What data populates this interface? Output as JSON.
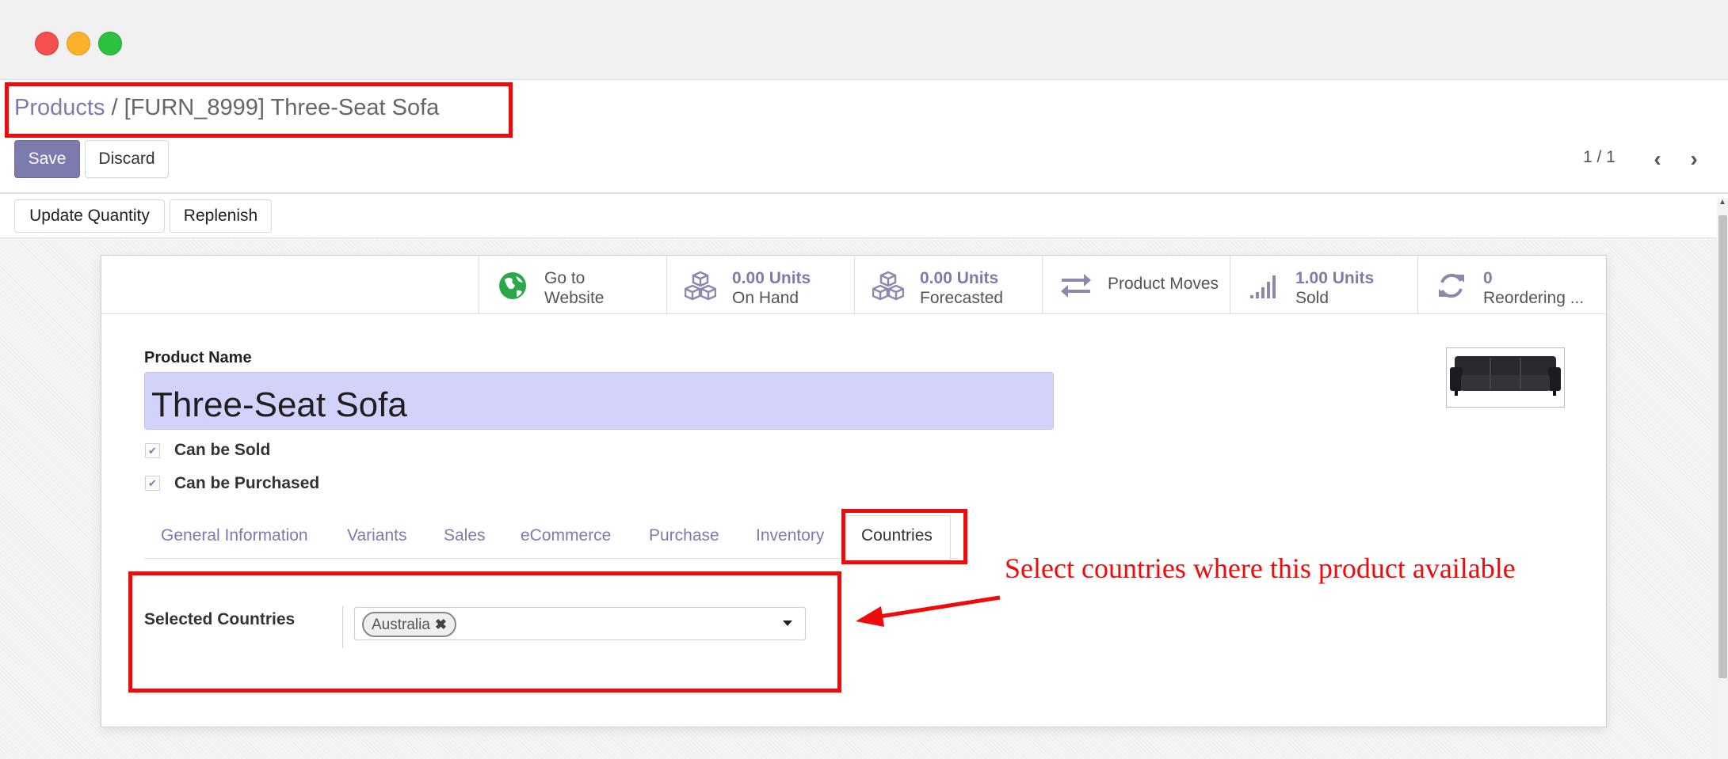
{
  "window": {
    "controls": [
      "close",
      "minimize",
      "maximize"
    ]
  },
  "breadcrumb": {
    "parent": "Products",
    "separator": "/",
    "current": "[FURN_8999] Three-Seat Sofa"
  },
  "toolbar": {
    "save_label": "Save",
    "discard_label": "Discard"
  },
  "pager": {
    "value": "1 / 1"
  },
  "actions": {
    "update_quantity": "Update Quantity",
    "replenish": "Replenish"
  },
  "smart_buttons": [
    {
      "icon": "globe-icon",
      "line1": "Go to",
      "line2": "Website"
    },
    {
      "icon": "cubes-icon",
      "value": "0.00 Units",
      "label": "On Hand"
    },
    {
      "icon": "cubes-icon",
      "value": "0.00 Units",
      "label": "Forecasted"
    },
    {
      "icon": "exchange-arrows-icon",
      "label": "Product Moves"
    },
    {
      "icon": "signal-bars-icon",
      "value": "1.00 Units",
      "label": "Sold"
    },
    {
      "icon": "refresh-icon",
      "value": "0",
      "label": "Reordering ..."
    }
  ],
  "form": {
    "product_name_label": "Product Name",
    "product_name_value": "Three-Seat Sofa",
    "can_be_sold_label": "Can be Sold",
    "can_be_sold": true,
    "can_be_purchased_label": "Can be Purchased",
    "can_be_purchased": true
  },
  "tabs": [
    {
      "label": "General Information",
      "active": false
    },
    {
      "label": "Variants",
      "active": false
    },
    {
      "label": "Sales",
      "active": false
    },
    {
      "label": "eCommerce",
      "active": false
    },
    {
      "label": "Purchase",
      "active": false
    },
    {
      "label": "Inventory",
      "active": false
    },
    {
      "label": "Countries",
      "active": true
    }
  ],
  "countries": {
    "label": "Selected Countries",
    "tags": [
      "Australia"
    ],
    "remove_glyph": "✖"
  },
  "annotation": {
    "text": "Select countries where this product available"
  },
  "colors": {
    "brand": "#7c7bad",
    "annotation_red": "#f00a0a",
    "input_bg": "#d2d2fb"
  }
}
